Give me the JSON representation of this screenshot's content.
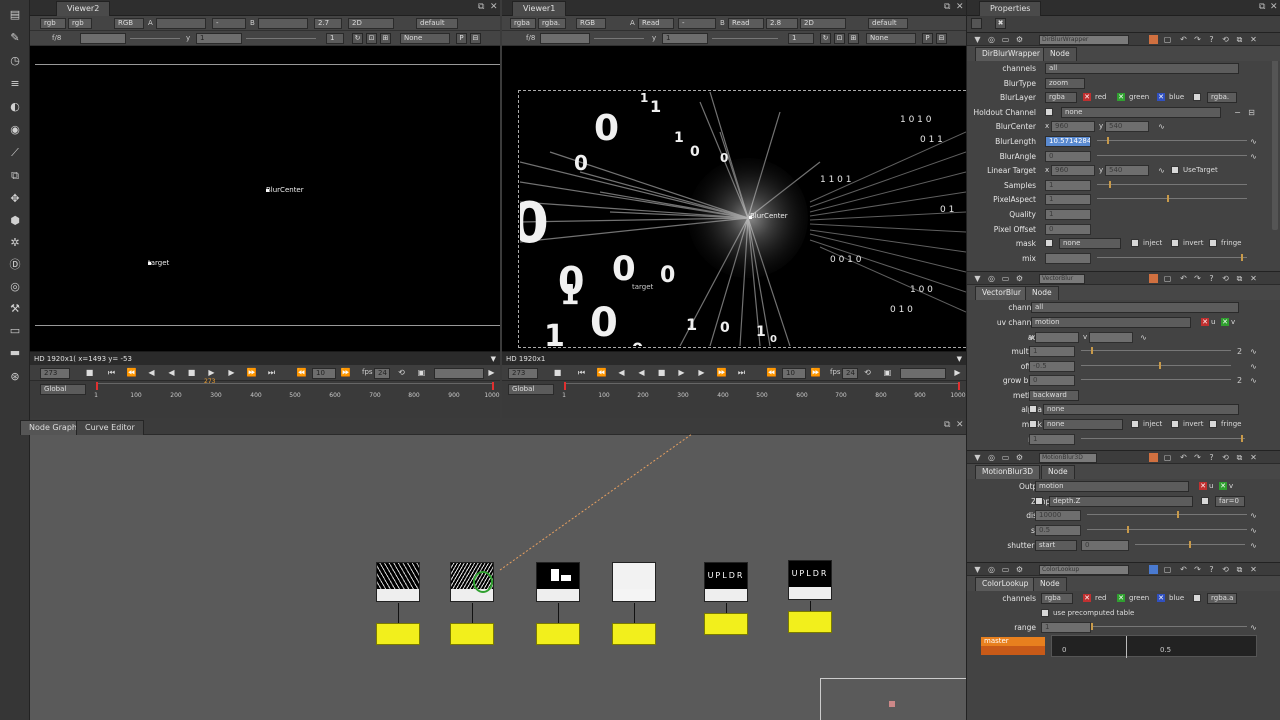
{
  "toolbar": {
    "icons": [
      "viewer-icon",
      "paint-icon",
      "time-icon",
      "channel-icon",
      "color-icon",
      "filter-icon",
      "keyer-icon",
      "merge-icon",
      "transform-icon",
      "3d-icon",
      "particles-icon",
      "deep-icon",
      "views-icon",
      "metadata-icon",
      "toolsets-icon",
      "other-icon"
    ]
  },
  "viewer2": {
    "tab": "Viewer2",
    "ch": "rgb",
    "ch2": "rgb",
    "cs": "RGB",
    "a_label": "A",
    "a_val": "",
    "dash": "-",
    "b_label": "B",
    "gain": "2.7",
    "mode": "2D",
    "lut": "default",
    "fstop": "f/8",
    "gamma": "1",
    "y_label": "y",
    "y_val": "1",
    "frame": "1",
    "roi": "None",
    "status": "HD 1920x1( x=1493 y= -53",
    "frame_field": "273",
    "fps_label": "fps",
    "fps_val": "24",
    "inc": "10",
    "range": "Global",
    "overlays": {
      "center": "BlurCenter",
      "target": "target"
    }
  },
  "viewer1": {
    "tab": "Viewer1",
    "ch": "rgba",
    "ch2": "rgba.",
    "cs": "RGB",
    "a_label": "A",
    "a_val": "Read",
    "dash": "-",
    "b_label": "B",
    "b_val": "Read",
    "gain": "2.8",
    "mode": "2D",
    "lut": "default",
    "fstop": "f/8",
    "gamma": "1",
    "y_label": "y",
    "frame": "1",
    "roi": "None",
    "status": "HD 1920x1",
    "frame_field": "273",
    "fps_label": "fps",
    "fps_val": "24",
    "inc": "10",
    "range": "Global",
    "overlays": {
      "center": "BlurCenter",
      "target": "target"
    }
  },
  "timeline": {
    "ticks": [
      "1",
      "100",
      "200",
      "300",
      "400",
      "500",
      "600",
      "700",
      "800",
      "900",
      "1000"
    ],
    "marker": "273"
  },
  "nodegraph": {
    "tabs": [
      "Node Graph",
      "Curve Editor"
    ],
    "nodes": [
      {
        "label": "UPLDR"
      },
      {
        "label": "UPLDR"
      }
    ],
    "ynodes": [
      "",
      "",
      "",
      "",
      "",
      ""
    ]
  },
  "properties": {
    "title": "Properties",
    "dirblur": {
      "header": "DirBlurWrapper",
      "tab1": "DirBlurWrapper",
      "tab2": "Node",
      "rows": {
        "channels": {
          "label": "channels",
          "val": "all"
        },
        "blurtype": {
          "label": "BlurType",
          "val": "zoom"
        },
        "blurlayer": {
          "label": "BlurLayer",
          "val": "rgba",
          "red": "red",
          "green": "green",
          "blue": "blue",
          "alpha": "rgba."
        },
        "holdout": {
          "label": "Holdout Channel",
          "val": "none"
        },
        "blurcenter": {
          "label": "BlurCenter",
          "x": "x",
          "xv": "960",
          "y": "y",
          "yv": "540"
        },
        "blurlength": {
          "label": "BlurLength",
          "val": "10.5714284"
        },
        "blurangle": {
          "label": "BlurAngle",
          "val": "0"
        },
        "lineartarget": {
          "label": "Linear Target",
          "x": "x",
          "xv": "960",
          "y": "y",
          "yv": "540",
          "use": "UseTarget"
        },
        "samples": {
          "label": "Samples",
          "val": "1"
        },
        "pixelaspect": {
          "label": "PixelAspect",
          "val": "1"
        },
        "quality": {
          "label": "Quality",
          "val": "1"
        },
        "pixeloffset": {
          "label": "Pixel Offset",
          "val": "0"
        },
        "mask": {
          "label": "mask",
          "val": "none",
          "inject": "inject",
          "invert": "invert",
          "fringe": "fringe"
        },
        "mix": {
          "label": "mix"
        }
      }
    },
    "vectorblur": {
      "header": "VectorBlur",
      "tab1": "VectorBlur",
      "tab2": "Node",
      "rows": {
        "channels": {
          "label": "channels",
          "val": "all"
        },
        "uv": {
          "label": "uv channels",
          "val": "motion",
          "u": "u",
          "v": "v"
        },
        "add": {
          "label": "add",
          "u": "u",
          "v": "v"
        },
        "multiply": {
          "label": "multiply",
          "val": "1"
        },
        "offset": {
          "label": "offset",
          "val": "-0.5"
        },
        "growbbox": {
          "label": "grow bbox",
          "val": "0"
        },
        "method": {
          "label": "method",
          "val": "backward"
        },
        "alpha": {
          "label": "alpha",
          "val": "none"
        },
        "mask": {
          "label": "mask",
          "val": "none",
          "inject": "inject",
          "invert": "invert",
          "fringe": "fringe"
        },
        "mix": {
          "label": "mix",
          "val": "1"
        }
      }
    },
    "motionblur": {
      "header": "MotionBlur3D",
      "tab1": "MotionBlur3D",
      "tab2": "Node",
      "rows": {
        "outputuv": {
          "label": "Output UV",
          "val": "motion",
          "u": "u",
          "v": "v"
        },
        "zinput": {
          "label": "Z input",
          "val": "depth.Z",
          "far": "far=0"
        },
        "distance": {
          "label": "distance",
          "val": "10000"
        },
        "shutter": {
          "label": "shutter",
          "val": "0.5"
        },
        "shutteroffset": {
          "label": "shutter offset",
          "val": "start",
          "v2": "0"
        }
      }
    },
    "colorlookup": {
      "header": "ColorLookup",
      "tab1": "ColorLookup",
      "tab2": "Node",
      "rows": {
        "channels": {
          "label": "channels",
          "val": "rgba",
          "red": "red",
          "green": "green",
          "blue": "blue",
          "alpha": "rgba.a"
        },
        "precomp": {
          "label": "use precomputed table"
        },
        "range": {
          "label": "range",
          "val": "1"
        },
        "master": {
          "label": "master"
        },
        "curve": {
          "t0": "0",
          "t1": "0.5"
        }
      }
    }
  },
  "colors": {
    "accent": "#f0a030",
    "yellow_node": "#f2ef1c",
    "bg": "#3b3b3b"
  }
}
